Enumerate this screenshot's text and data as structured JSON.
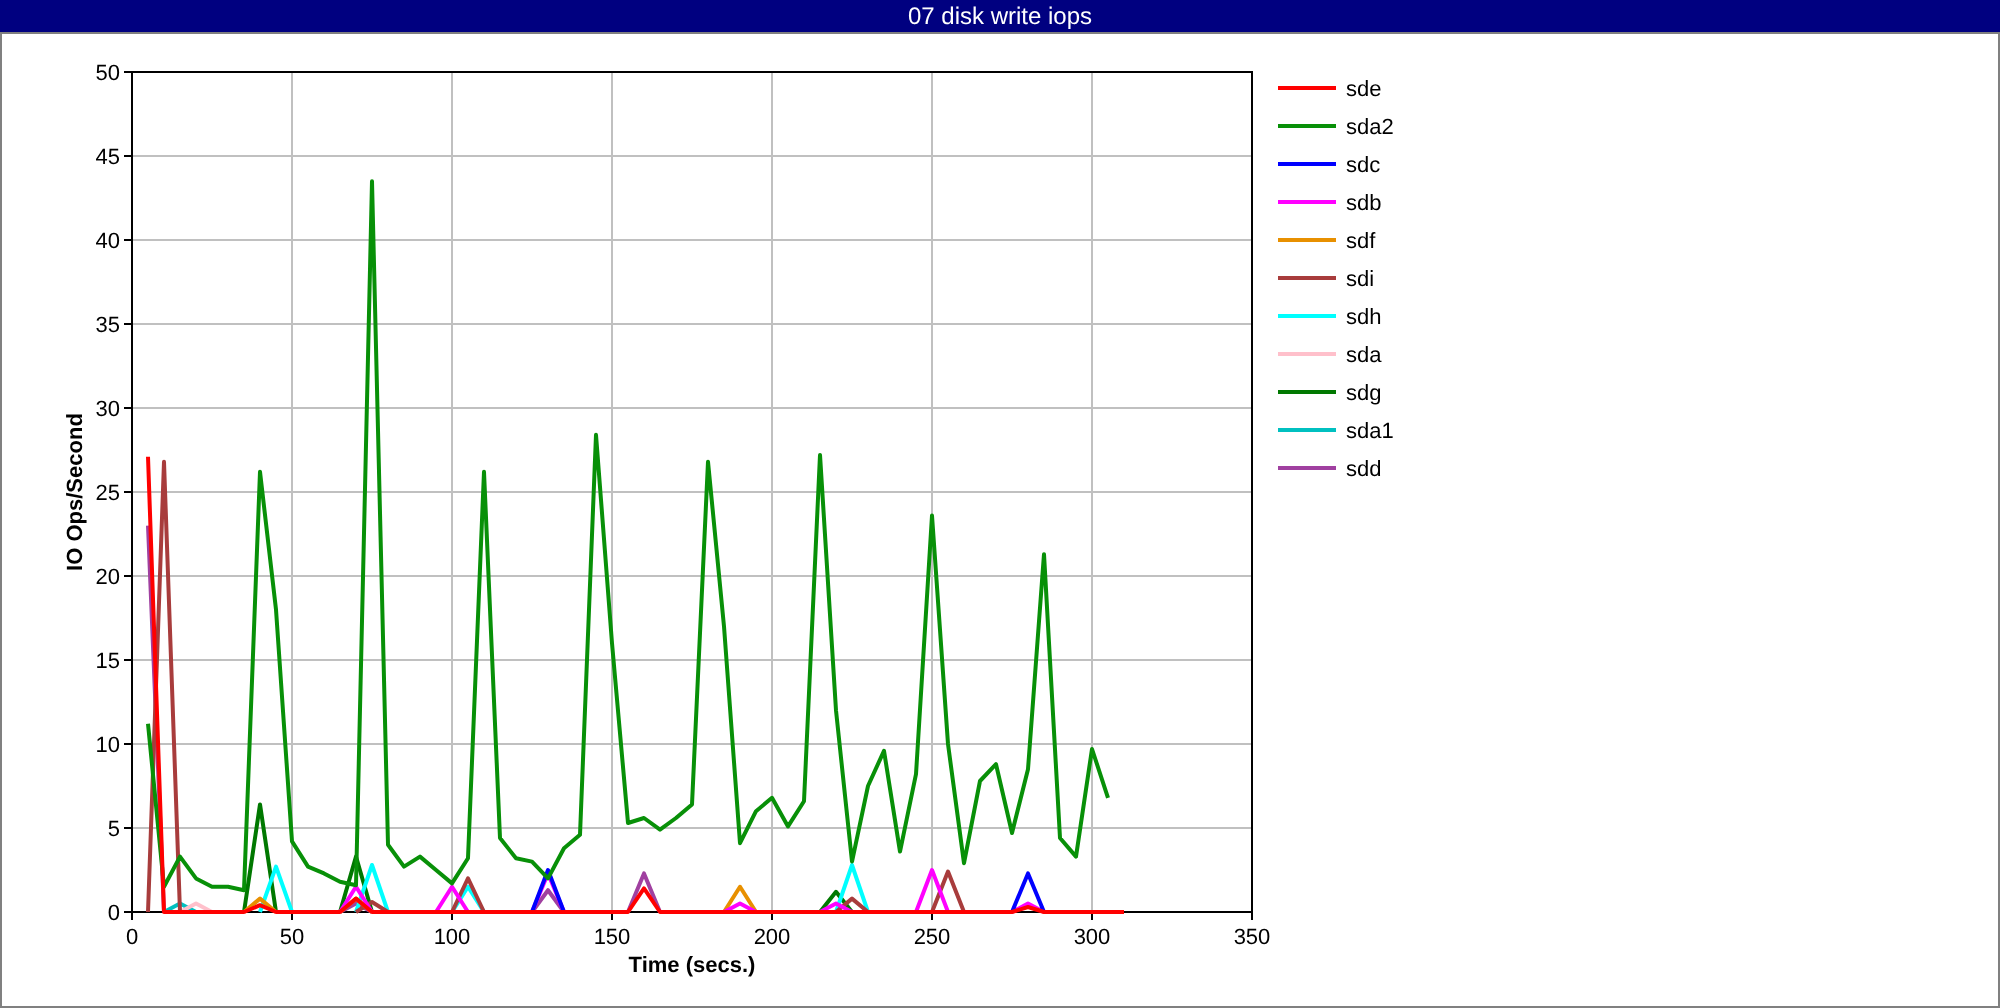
{
  "window": {
    "title": "07 disk write iops"
  },
  "chart_data": {
    "type": "line",
    "xlabel": "Time (secs.)",
    "ylabel": "IO Ops/Second",
    "xlim": [
      0,
      350
    ],
    "ylim": [
      0,
      50
    ],
    "xticks": [
      0,
      50,
      100,
      150,
      200,
      250,
      300,
      350
    ],
    "yticks": [
      0,
      5,
      10,
      15,
      20,
      25,
      30,
      35,
      40,
      45,
      50
    ],
    "grid": true,
    "legend": true,
    "x": [
      5,
      10,
      15,
      20,
      25,
      30,
      35,
      40,
      45,
      50,
      55,
      60,
      65,
      70,
      75,
      80,
      85,
      90,
      95,
      100,
      105,
      110,
      115,
      120,
      125,
      130,
      135,
      140,
      145,
      150,
      155,
      160,
      165,
      170,
      175,
      180,
      185,
      190,
      195,
      200,
      205,
      210,
      215,
      220,
      225,
      230,
      235,
      240,
      245,
      250,
      255,
      260,
      265,
      270,
      275,
      280,
      285,
      290,
      295,
      300,
      305,
      310
    ],
    "series": [
      {
        "name": "sde",
        "color": "#ff0000",
        "values": [
          27.1,
          0,
          0,
          0,
          0,
          0,
          0,
          0.4,
          0,
          0,
          0,
          0,
          0,
          0.8,
          0,
          0,
          0,
          0,
          0,
          0,
          0,
          0,
          0,
          0,
          0,
          0,
          0,
          0,
          0,
          0,
          0,
          1.4,
          0,
          0,
          0,
          0,
          0,
          0,
          0,
          0,
          0,
          0,
          0,
          0,
          0,
          0,
          0,
          0,
          0,
          0,
          0,
          0,
          0,
          0,
          0,
          0.3,
          0,
          0,
          0,
          0,
          0,
          0
        ]
      },
      {
        "name": "sda2",
        "color": "#089008",
        "values": [
          11.2,
          1.5,
          3.3,
          2.0,
          1.5,
          1.5,
          1.3,
          26.2,
          18,
          4.2,
          2.7,
          2.3,
          1.8,
          1.6,
          43.5,
          4.0,
          2.7,
          3.3,
          2.5,
          1.7,
          3.2,
          26.2,
          4.4,
          3.2,
          3.0,
          2.0,
          3.8,
          4.6,
          28.4,
          16,
          5.3,
          5.6,
          4.9,
          5.6,
          6.4,
          26.8,
          17,
          4.1,
          6.0,
          6.8,
          5.1,
          6.6,
          27.2,
          12,
          3.0,
          7.5,
          9.6,
          3.6,
          8.2,
          23.6,
          10,
          2.9,
          7.8,
          8.8,
          4.7,
          8.5,
          21.3,
          4.4,
          3.3,
          9.7,
          6.8,
          null
        ]
      },
      {
        "name": "sdc",
        "color": "#0000ff",
        "values": [
          null,
          null,
          null,
          null,
          null,
          null,
          null,
          null,
          null,
          null,
          null,
          null,
          null,
          null,
          null,
          null,
          null,
          null,
          null,
          null,
          null,
          null,
          null,
          null,
          0,
          2.5,
          0,
          null,
          null,
          null,
          null,
          null,
          null,
          null,
          null,
          null,
          null,
          null,
          null,
          null,
          null,
          null,
          null,
          null,
          null,
          null,
          null,
          null,
          null,
          null,
          null,
          null,
          null,
          null,
          0,
          2.3,
          0,
          null,
          null,
          null,
          null,
          null
        ]
      },
      {
        "name": "sdb",
        "color": "#ff00ff",
        "values": [
          null,
          null,
          null,
          null,
          null,
          null,
          null,
          null,
          null,
          null,
          null,
          null,
          0,
          1.5,
          0,
          null,
          null,
          null,
          0,
          1.5,
          0,
          null,
          null,
          null,
          0,
          2.3,
          0,
          null,
          null,
          null,
          null,
          null,
          null,
          null,
          null,
          null,
          0,
          0.5,
          0,
          null,
          null,
          null,
          0,
          0.5,
          0,
          null,
          null,
          null,
          0,
          2.5,
          0,
          null,
          null,
          null,
          0,
          0.5,
          0,
          null,
          null,
          null,
          null,
          null
        ]
      },
      {
        "name": "sdf",
        "color": "#e89000",
        "values": [
          null,
          null,
          null,
          null,
          null,
          null,
          0,
          0.8,
          0,
          null,
          null,
          null,
          0,
          0.8,
          0,
          null,
          null,
          null,
          null,
          null,
          null,
          null,
          null,
          null,
          null,
          null,
          null,
          null,
          null,
          null,
          null,
          null,
          null,
          null,
          null,
          null,
          0,
          1.5,
          0,
          null,
          null,
          null,
          null,
          null,
          null,
          null,
          null,
          null,
          null,
          null,
          null,
          null,
          null,
          null,
          null,
          null,
          null,
          null,
          null,
          null,
          null,
          null
        ]
      },
      {
        "name": "sdi",
        "color": "#a83c3c",
        "values": [
          0,
          26.8,
          0,
          null,
          null,
          null,
          null,
          null,
          null,
          null,
          null,
          null,
          null,
          0,
          0.6,
          0,
          null,
          null,
          null,
          0,
          2.0,
          0,
          null,
          null,
          null,
          null,
          null,
          null,
          null,
          null,
          null,
          null,
          null,
          null,
          null,
          null,
          null,
          null,
          null,
          null,
          null,
          null,
          null,
          0,
          0.8,
          0,
          null,
          null,
          null,
          0,
          2.4,
          0,
          null,
          null,
          null,
          null,
          null,
          null,
          null,
          null,
          null,
          null
        ]
      },
      {
        "name": "sdh",
        "color": "#00ffff",
        "values": [
          null,
          null,
          null,
          null,
          null,
          null,
          null,
          0,
          2.7,
          0,
          null,
          null,
          null,
          0,
          2.8,
          0,
          null,
          null,
          null,
          0,
          1.5,
          0,
          null,
          null,
          null,
          null,
          null,
          null,
          null,
          null,
          null,
          null,
          null,
          null,
          null,
          null,
          null,
          null,
          null,
          null,
          null,
          null,
          null,
          0,
          2.8,
          0,
          null,
          null,
          null,
          null,
          null,
          null,
          null,
          null,
          null,
          null,
          null,
          null,
          null,
          null,
          null,
          null
        ]
      },
      {
        "name": "sda",
        "color": "#ffc0cb",
        "values": [
          null,
          null,
          0,
          0.5,
          0,
          null,
          null,
          null,
          null,
          null,
          null,
          null,
          null,
          null,
          null,
          null,
          null,
          null,
          null,
          null,
          null,
          null,
          null,
          null,
          null,
          null,
          null,
          null,
          null,
          null,
          null,
          null,
          null,
          null,
          null,
          null,
          null,
          null,
          null,
          null,
          null,
          null,
          null,
          null,
          null,
          null,
          null,
          null,
          null,
          null,
          null,
          null,
          null,
          null,
          null,
          null,
          null,
          null,
          null,
          null,
          null,
          null
        ]
      },
      {
        "name": "sdg",
        "color": "#007800",
        "values": [
          null,
          null,
          null,
          null,
          null,
          null,
          0,
          6.4,
          0,
          null,
          null,
          null,
          0,
          3.3,
          0,
          null,
          null,
          null,
          null,
          null,
          null,
          null,
          null,
          null,
          null,
          null,
          null,
          null,
          null,
          null,
          null,
          null,
          null,
          null,
          null,
          null,
          null,
          null,
          null,
          null,
          null,
          null,
          0,
          1.2,
          0,
          null,
          null,
          null,
          null,
          null,
          null,
          null,
          null,
          null,
          null,
          null,
          null,
          null,
          null,
          null,
          null,
          null
        ]
      },
      {
        "name": "sda1",
        "color": "#00c0c0",
        "values": [
          null,
          0,
          0.5,
          0,
          null,
          null,
          null,
          null,
          null,
          null,
          null,
          null,
          null,
          null,
          null,
          null,
          null,
          null,
          null,
          null,
          null,
          null,
          null,
          null,
          null,
          null,
          null,
          null,
          null,
          null,
          null,
          null,
          null,
          null,
          null,
          null,
          null,
          null,
          null,
          null,
          null,
          null,
          null,
          null,
          null,
          null,
          null,
          null,
          null,
          null,
          null,
          null,
          null,
          null,
          null,
          null,
          null,
          null,
          null,
          null,
          null,
          null
        ]
      },
      {
        "name": "sdd",
        "color": "#a040a0",
        "values": [
          23,
          0,
          null,
          null,
          null,
          null,
          null,
          null,
          null,
          null,
          null,
          null,
          0,
          0.5,
          0,
          null,
          null,
          null,
          null,
          null,
          null,
          null,
          null,
          null,
          0,
          1.3,
          0,
          null,
          null,
          null,
          0,
          2.3,
          0,
          null,
          null,
          null,
          null,
          null,
          null,
          null,
          null,
          null,
          null,
          null,
          null,
          null,
          null,
          null,
          null,
          null,
          null,
          null,
          null,
          null,
          null,
          null,
          null,
          null,
          null,
          null,
          null,
          null
        ]
      }
    ]
  }
}
